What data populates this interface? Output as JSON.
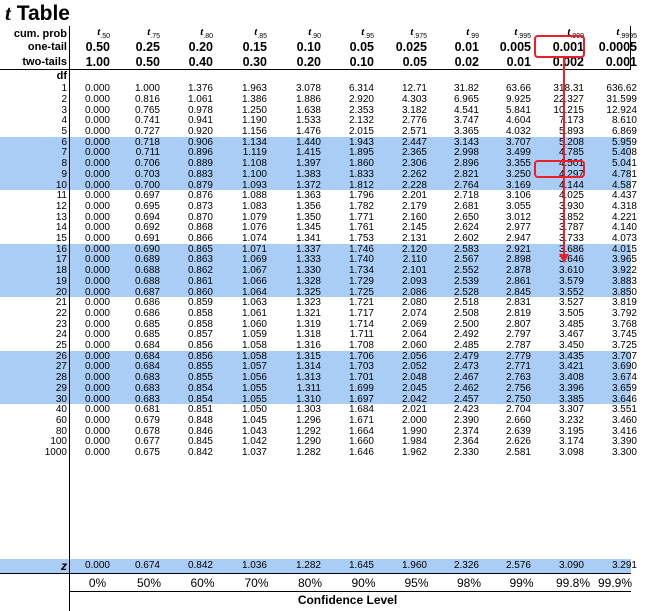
{
  "title": "Table",
  "title_symbol": "t",
  "labels": {
    "cum_prob": "cum. prob",
    "one_tail": "one-tail",
    "two_tails": "two-tails",
    "df": "df",
    "z": "z",
    "confidence_level": "Confidence Level"
  },
  "columns": [
    {
      "sub": ".50",
      "one_tail": "0.50",
      "two_tails": "1.00",
      "conf": "0%"
    },
    {
      "sub": ".75",
      "one_tail": "0.25",
      "two_tails": "0.50",
      "conf": "50%"
    },
    {
      "sub": ".80",
      "one_tail": "0.20",
      "two_tails": "0.40",
      "conf": "60%"
    },
    {
      "sub": ".85",
      "one_tail": "0.15",
      "two_tails": "0.30",
      "conf": "70%"
    },
    {
      "sub": ".90",
      "one_tail": "0.10",
      "two_tails": "0.20",
      "conf": "80%"
    },
    {
      "sub": ".95",
      "one_tail": "0.05",
      "two_tails": "0.10",
      "conf": "90%"
    },
    {
      "sub": ".975",
      "one_tail": "0.025",
      "two_tails": "0.05",
      "conf": "95%"
    },
    {
      "sub": ".99",
      "one_tail": "0.01",
      "two_tails": "0.02",
      "conf": "98%"
    },
    {
      "sub": ".995",
      "one_tail": "0.005",
      "two_tails": "0.01",
      "conf": "99%"
    },
    {
      "sub": ".999",
      "one_tail": "0.001",
      "two_tails": "0.002",
      "conf": "99.8%"
    },
    {
      "sub": ".9995",
      "one_tail": "0.0005",
      "two_tails": "0.001",
      "conf": "99.9%"
    }
  ],
  "rows": [
    {
      "df": "1",
      "v": [
        "0.000",
        "1.000",
        "1.376",
        "1.963",
        "3.078",
        "6.314",
        "12.71",
        "31.82",
        "63.66",
        "318.31",
        "636.62"
      ]
    },
    {
      "df": "2",
      "v": [
        "0.000",
        "0.816",
        "1.061",
        "1.386",
        "1.886",
        "2.920",
        "4.303",
        "6.965",
        "9.925",
        "22.327",
        "31.599"
      ]
    },
    {
      "df": "3",
      "v": [
        "0.000",
        "0.765",
        "0.978",
        "1.250",
        "1.638",
        "2.353",
        "3.182",
        "4.541",
        "5.841",
        "10.215",
        "12.924"
      ]
    },
    {
      "df": "4",
      "v": [
        "0.000",
        "0.741",
        "0.941",
        "1.190",
        "1.533",
        "2.132",
        "2.776",
        "3.747",
        "4.604",
        "7.173",
        "8.610"
      ]
    },
    {
      "df": "5",
      "v": [
        "0.000",
        "0.727",
        "0.920",
        "1.156",
        "1.476",
        "2.015",
        "2.571",
        "3.365",
        "4.032",
        "5.893",
        "6.869"
      ]
    },
    {
      "df": "6",
      "v": [
        "0.000",
        "0.718",
        "0.906",
        "1.134",
        "1.440",
        "1.943",
        "2.447",
        "3.143",
        "3.707",
        "5.208",
        "5.959"
      ]
    },
    {
      "df": "7",
      "v": [
        "0.000",
        "0.711",
        "0.896",
        "1.119",
        "1.415",
        "1.895",
        "2.365",
        "2.998",
        "3.499",
        "4.785",
        "5.408"
      ]
    },
    {
      "df": "8",
      "v": [
        "0.000",
        "0.706",
        "0.889",
        "1.108",
        "1.397",
        "1.860",
        "2.306",
        "2.896",
        "3.355",
        "4.501",
        "5.041"
      ]
    },
    {
      "df": "9",
      "v": [
        "0.000",
        "0.703",
        "0.883",
        "1.100",
        "1.383",
        "1.833",
        "2.262",
        "2.821",
        "3.250",
        "4.297",
        "4.781"
      ]
    },
    {
      "df": "10",
      "v": [
        "0.000",
        "0.700",
        "0.879",
        "1.093",
        "1.372",
        "1.812",
        "2.228",
        "2.764",
        "3.169",
        "4.144",
        "4.587"
      ]
    },
    {
      "df": "11",
      "v": [
        "0.000",
        "0.697",
        "0.876",
        "1.088",
        "1.363",
        "1.796",
        "2.201",
        "2.718",
        "3.106",
        "4.025",
        "4.437"
      ]
    },
    {
      "df": "12",
      "v": [
        "0.000",
        "0.695",
        "0.873",
        "1.083",
        "1.356",
        "1.782",
        "2.179",
        "2.681",
        "3.055",
        "3.930",
        "4.318"
      ]
    },
    {
      "df": "13",
      "v": [
        "0.000",
        "0.694",
        "0.870",
        "1.079",
        "1.350",
        "1.771",
        "2.160",
        "2.650",
        "3.012",
        "3.852",
        "4.221"
      ]
    },
    {
      "df": "14",
      "v": [
        "0.000",
        "0.692",
        "0.868",
        "1.076",
        "1.345",
        "1.761",
        "2.145",
        "2.624",
        "2.977",
        "3.787",
        "4.140"
      ]
    },
    {
      "df": "15",
      "v": [
        "0.000",
        "0.691",
        "0.866",
        "1.074",
        "1.341",
        "1.753",
        "2.131",
        "2.602",
        "2.947",
        "3.733",
        "4.073"
      ]
    },
    {
      "df": "16",
      "v": [
        "0.000",
        "0.690",
        "0.865",
        "1.071",
        "1.337",
        "1.746",
        "2.120",
        "2.583",
        "2.921",
        "3.686",
        "4.015"
      ]
    },
    {
      "df": "17",
      "v": [
        "0.000",
        "0.689",
        "0.863",
        "1.069",
        "1.333",
        "1.740",
        "2.110",
        "2.567",
        "2.898",
        "3.646",
        "3.965"
      ]
    },
    {
      "df": "18",
      "v": [
        "0.000",
        "0.688",
        "0.862",
        "1.067",
        "1.330",
        "1.734",
        "2.101",
        "2.552",
        "2.878",
        "3.610",
        "3.922"
      ]
    },
    {
      "df": "19",
      "v": [
        "0.000",
        "0.688",
        "0.861",
        "1.066",
        "1.328",
        "1.729",
        "2.093",
        "2.539",
        "2.861",
        "3.579",
        "3.883"
      ]
    },
    {
      "df": "20",
      "v": [
        "0.000",
        "0.687",
        "0.860",
        "1.064",
        "1.325",
        "1.725",
        "2.086",
        "2.528",
        "2.845",
        "3.552",
        "3.850"
      ]
    },
    {
      "df": "21",
      "v": [
        "0.000",
        "0.686",
        "0.859",
        "1.063",
        "1.323",
        "1.721",
        "2.080",
        "2.518",
        "2.831",
        "3.527",
        "3.819"
      ]
    },
    {
      "df": "22",
      "v": [
        "0.000",
        "0.686",
        "0.858",
        "1.061",
        "1.321",
        "1.717",
        "2.074",
        "2.508",
        "2.819",
        "3.505",
        "3.792"
      ]
    },
    {
      "df": "23",
      "v": [
        "0.000",
        "0.685",
        "0.858",
        "1.060",
        "1.319",
        "1.714",
        "2.069",
        "2.500",
        "2.807",
        "3.485",
        "3.768"
      ]
    },
    {
      "df": "24",
      "v": [
        "0.000",
        "0.685",
        "0.857",
        "1.059",
        "1.318",
        "1.711",
        "2.064",
        "2.492",
        "2.797",
        "3.467",
        "3.745"
      ]
    },
    {
      "df": "25",
      "v": [
        "0.000",
        "0.684",
        "0.856",
        "1.058",
        "1.316",
        "1.708",
        "2.060",
        "2.485",
        "2.787",
        "3.450",
        "3.725"
      ]
    },
    {
      "df": "26",
      "v": [
        "0.000",
        "0.684",
        "0.856",
        "1.058",
        "1.315",
        "1.706",
        "2.056",
        "2.479",
        "2.779",
        "3.435",
        "3.707"
      ]
    },
    {
      "df": "27",
      "v": [
        "0.000",
        "0.684",
        "0.855",
        "1.057",
        "1.314",
        "1.703",
        "2.052",
        "2.473",
        "2.771",
        "3.421",
        "3.690"
      ]
    },
    {
      "df": "28",
      "v": [
        "0.000",
        "0.683",
        "0.855",
        "1.056",
        "1.313",
        "1.701",
        "2.048",
        "2.467",
        "2.763",
        "3.408",
        "3.674"
      ]
    },
    {
      "df": "29",
      "v": [
        "0.000",
        "0.683",
        "0.854",
        "1.055",
        "1.311",
        "1.699",
        "2.045",
        "2.462",
        "2.756",
        "3.396",
        "3.659"
      ]
    },
    {
      "df": "30",
      "v": [
        "0.000",
        "0.683",
        "0.854",
        "1.055",
        "1.310",
        "1.697",
        "2.042",
        "2.457",
        "2.750",
        "3.385",
        "3.646"
      ]
    },
    {
      "df": "40",
      "v": [
        "0.000",
        "0.681",
        "0.851",
        "1.050",
        "1.303",
        "1.684",
        "2.021",
        "2.423",
        "2.704",
        "3.307",
        "3.551"
      ]
    },
    {
      "df": "60",
      "v": [
        "0.000",
        "0.679",
        "0.848",
        "1.045",
        "1.296",
        "1.671",
        "2.000",
        "2.390",
        "2.660",
        "3.232",
        "3.460"
      ]
    },
    {
      "df": "80",
      "v": [
        "0.000",
        "0.678",
        "0.846",
        "1.043",
        "1.292",
        "1.664",
        "1.990",
        "2.374",
        "2.639",
        "3.195",
        "3.416"
      ]
    },
    {
      "df": "100",
      "v": [
        "0.000",
        "0.677",
        "0.845",
        "1.042",
        "1.290",
        "1.660",
        "1.984",
        "2.364",
        "2.626",
        "3.174",
        "3.390"
      ]
    },
    {
      "df": "1000",
      "v": [
        "0.000",
        "0.675",
        "0.842",
        "1.037",
        "1.282",
        "1.646",
        "1.962",
        "2.330",
        "2.581",
        "3.098",
        "3.300"
      ]
    }
  ],
  "z_row": [
    "0.000",
    "0.674",
    "0.842",
    "1.036",
    "1.282",
    "1.645",
    "1.960",
    "2.326",
    "2.576",
    "3.090",
    "3.291"
  ],
  "colors": {
    "band": "#aacdf5",
    "highlight": "#e8202a"
  }
}
